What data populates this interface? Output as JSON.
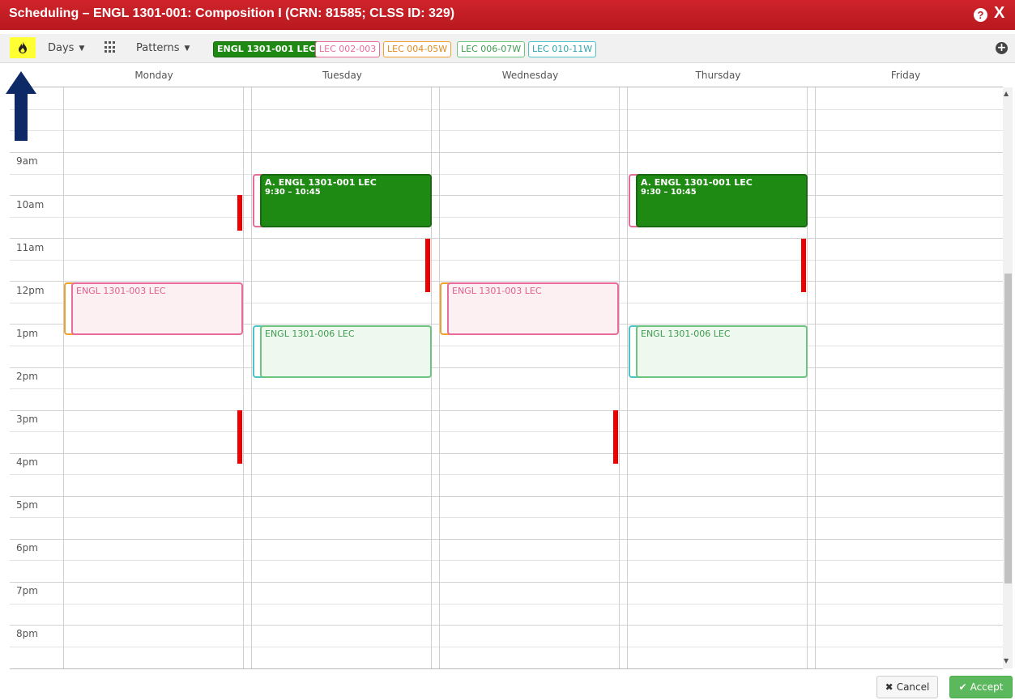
{
  "window": {
    "title": "Scheduling – ENGL 1301-001: Composition I (CRN: 81585; CLSS ID: 329)",
    "help_glyph": "?",
    "close_glyph": "X"
  },
  "toolbar": {
    "flame_icon": "flame-icon",
    "days_label": "Days",
    "patterns_label": "Patterns",
    "chips": [
      {
        "label": "ENGL 1301-001 LEC",
        "color": "#1f8a13"
      },
      {
        "label": "LEC 002-003",
        "color": "#e86b9b"
      },
      {
        "label": "LEC 004-05W",
        "color": "#f0a030"
      },
      {
        "label": "LEC 006-07W",
        "color": "#6cc57f"
      },
      {
        "label": "LEC 010-11W",
        "color": "#4fc1c9"
      }
    ],
    "add_icon": "plus-circle-icon"
  },
  "days": [
    "Monday",
    "Tuesday",
    "Wednesday",
    "Thursday",
    "Friday"
  ],
  "times": [
    "9am",
    "10am",
    "11am",
    "12pm",
    "1pm",
    "2pm",
    "3pm",
    "4pm",
    "5pm",
    "6pm",
    "7pm",
    "8pm"
  ],
  "events": {
    "tue_main": {
      "title": "A. ENGL 1301-001 LEC",
      "time": "9:30 – 10:45"
    },
    "thu_main": {
      "title": "A. ENGL 1301-001 LEC",
      "time": "9:30 – 10:45"
    },
    "mon_noon": {
      "title": "ENGL 1301-003 LEC"
    },
    "wed_noon": {
      "title": "ENGL 1301-003 LEC"
    },
    "tue_one": {
      "title": "ENGL 1301-006 LEC"
    },
    "thu_one": {
      "title": "ENGL 1301-006 LEC"
    }
  },
  "buttons": {
    "cancel": "Cancel",
    "accept": "Accept"
  },
  "colors": {
    "title_bar": "#c41e24",
    "selected_section": "#1f8a13",
    "conflict": "#ee0000"
  }
}
